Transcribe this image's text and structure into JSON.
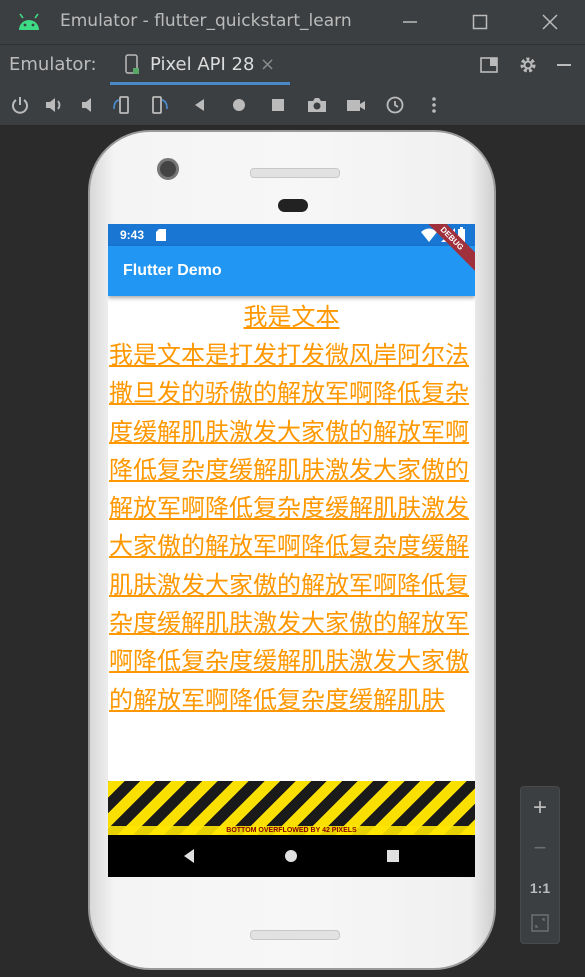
{
  "window": {
    "title": "Emulator - flutter_quickstart_learn"
  },
  "tabbar": {
    "label": "Emulator:",
    "tab_name": "Pixel API 28",
    "tab_close": "×"
  },
  "device": {
    "status_time": "9:43",
    "debug_banner": "DEBUG",
    "app_title": "Flutter Demo",
    "heading": "我是文本",
    "paragraph": "我是文本是打发打发微风岸阿尔法撒旦发的骄傲的解放军啊降低复杂度缓解肌肤激发大家傲的解放军啊降低复杂度缓解肌肤激发大家傲的解放军啊降低复杂度缓解肌肤激发大家傲的解放军啊降低复杂度缓解肌肤激发大家傲的解放军啊降低复杂度缓解肌肤激发大家傲的解放军啊降低复杂度缓解肌肤激发大家傲的解放军啊降低复杂度缓解肌肤",
    "overflow_message": "BOTTOM OVERFLOWED BY 42 PIXELS"
  },
  "side_panel": {
    "zoom_in": "+",
    "zoom_out": "−",
    "one_to_one": "1:1"
  },
  "colors": {
    "accent_text": "#ff9800",
    "app_bar": "#2196f3",
    "status_bar": "#1976d2"
  }
}
